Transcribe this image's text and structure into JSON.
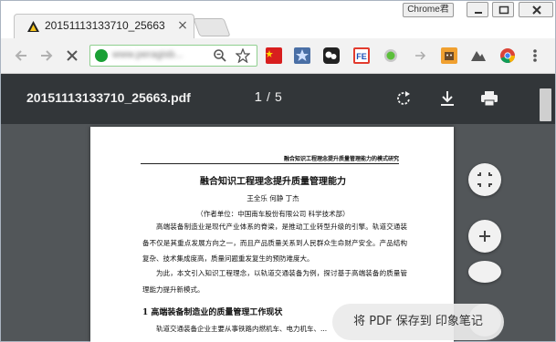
{
  "browser": {
    "tab_title": "20151113133710_25663",
    "profile_label": "Chrome君",
    "url": "www.peragisb...",
    "colors": {
      "accent_green": "#1aa035",
      "badge_red": "#d22222"
    }
  },
  "toolbar": {
    "back_icon": "arrow-left-icon",
    "forward_icon": "arrow-right-icon",
    "reload_icon": "close-icon",
    "extension_badge": "1",
    "extensions": [
      "flag-cn-icon",
      "bookmark-star-icon",
      "weixin-icon",
      "fe-icon",
      "circle-green-icon",
      "arrow-icon",
      "fox-icon",
      "mountain-icon",
      "chrome-icon"
    ]
  },
  "pdf": {
    "file_name": "20151113133710_25663.pdf",
    "current_page": "1",
    "page_separator": "/",
    "total_pages": "5"
  },
  "document": {
    "running_head": "融合知识工程理念提升质量管理能力的模式研究",
    "title": "融合知识工程理念提升质量管理能力",
    "authors": "王全乐  何静  丁杰",
    "affiliation": "（作者单位：中国南车股份有限公司  科学技术部）",
    "paragraph1": "高端装备制造业是现代产业体系的脊梁，是推动工业转型升级的引擎。轨道交通装备不仅是其重点发展方向之一，而且产品质量关系到人民群众生命财产安全。产品结构复杂、技术集成度高，质量问题重发复生的预防难度大。",
    "paragraph2": "为此，本文引入知识工程理念，以轨道交通装备为例，探讨基于高端装备的质量管理能力提升新模式。",
    "section_heading": "1  高端装备制造业的质量管理工作现状",
    "paragraph3": "轨道交通装备企业主要从事铁路内燃机车、电力机车、..."
  },
  "toast": {
    "label": "将 PDF 保存到 印象笔记"
  }
}
